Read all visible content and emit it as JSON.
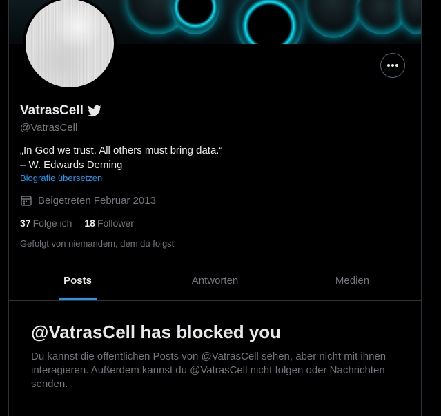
{
  "profile": {
    "display_name": "VatrasCell",
    "handle": "@VatrasCell",
    "bio_line1": "„In God we trust. All others must bring data.“",
    "bio_line2": "– W. Edwards Deming",
    "translate_link": "Biografie übersetzen",
    "joined": "Beigetreten Februar 2013",
    "following_count": "37",
    "following_label": "Folge ich",
    "followers_count": "18",
    "followers_label": "Follower",
    "followed_by": "Gefolgt von niemandem, dem du folgst",
    "more_button_label": "•••"
  },
  "tabs": [
    {
      "label": "Posts",
      "active": true
    },
    {
      "label": "Antworten",
      "active": false
    },
    {
      "label": "Medien",
      "active": false
    }
  ],
  "blocked": {
    "title": "@VatrasCell has blocked you",
    "message": "Du kannst die öffentlichen Posts von @VatrasCell sehen, aber nicht mit ihnen interagieren. Außerdem kannst du @VatrasCell nicht folgen oder Nachrichten senden."
  },
  "icons": {
    "verified": "twitter-bird-icon",
    "joined": "calendar-icon",
    "more": "more-options-icon"
  },
  "colors": {
    "background": "#000000",
    "accent": "#1d9bf0",
    "text_primary": "#e7e9ea",
    "text_secondary": "#71767b",
    "border": "#2f3336",
    "banner_glow": "#00e5ff"
  }
}
